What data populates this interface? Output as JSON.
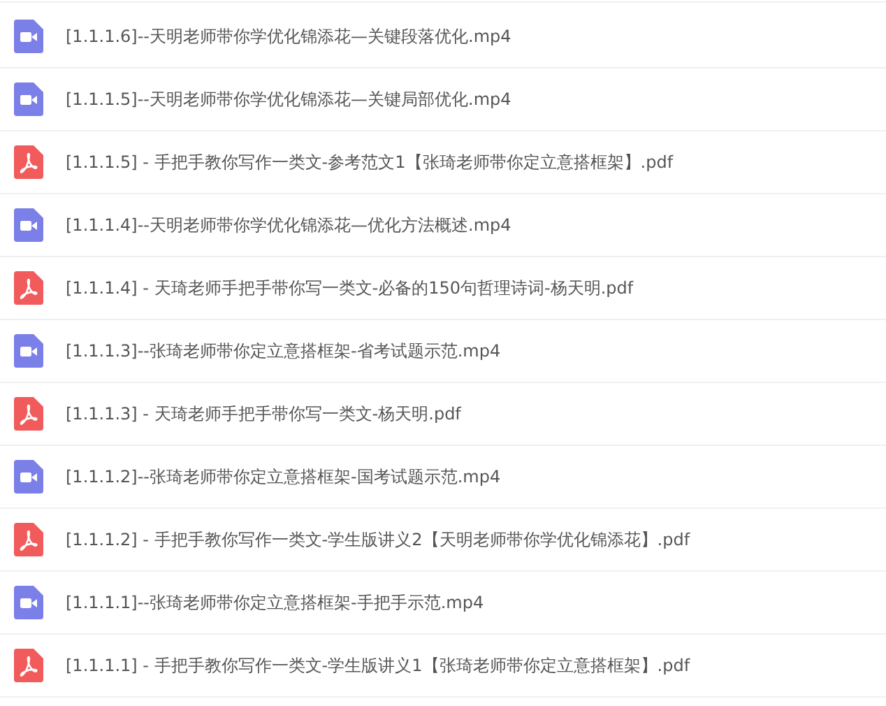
{
  "files": [
    {
      "kind": "video",
      "name": "[1.1.1.6]--天明老师带你学优化锦添花—关键段落优化.mp4"
    },
    {
      "kind": "video",
      "name": "[1.1.1.5]--天明老师带你学优化锦添花—关键局部优化.mp4"
    },
    {
      "kind": "pdf",
      "name": "[1.1.1.5] - 手把手教你写作一类文-参考范文1【张琦老师带你定立意搭框架】.pdf"
    },
    {
      "kind": "video",
      "name": "[1.1.1.4]--天明老师带你学优化锦添花—优化方法概述.mp4"
    },
    {
      "kind": "pdf",
      "name": "[1.1.1.4] - 天琦老师手把手带你写一类文-必备的150句哲理诗词-杨天明.pdf"
    },
    {
      "kind": "video",
      "name": "[1.1.1.3]--张琦老师带你定立意搭框架-省考试题示范.mp4"
    },
    {
      "kind": "pdf",
      "name": "[1.1.1.3] - 天琦老师手把手带你写一类文-杨天明.pdf"
    },
    {
      "kind": "video",
      "name": "[1.1.1.2]--张琦老师带你定立意搭框架-国考试题示范.mp4"
    },
    {
      "kind": "pdf",
      "name": "[1.1.1.2] - 手把手教你写作一类文-学生版讲义2【天明老师带你学优化锦添花】.pdf"
    },
    {
      "kind": "video",
      "name": "[1.1.1.1]--张琦老师带你定立意搭框架-手把手示范.mp4"
    },
    {
      "kind": "pdf",
      "name": "[1.1.1.1] - 手把手教你写作一类文-学生版讲义1【张琦老师带你定立意搭框架】.pdf"
    }
  ]
}
